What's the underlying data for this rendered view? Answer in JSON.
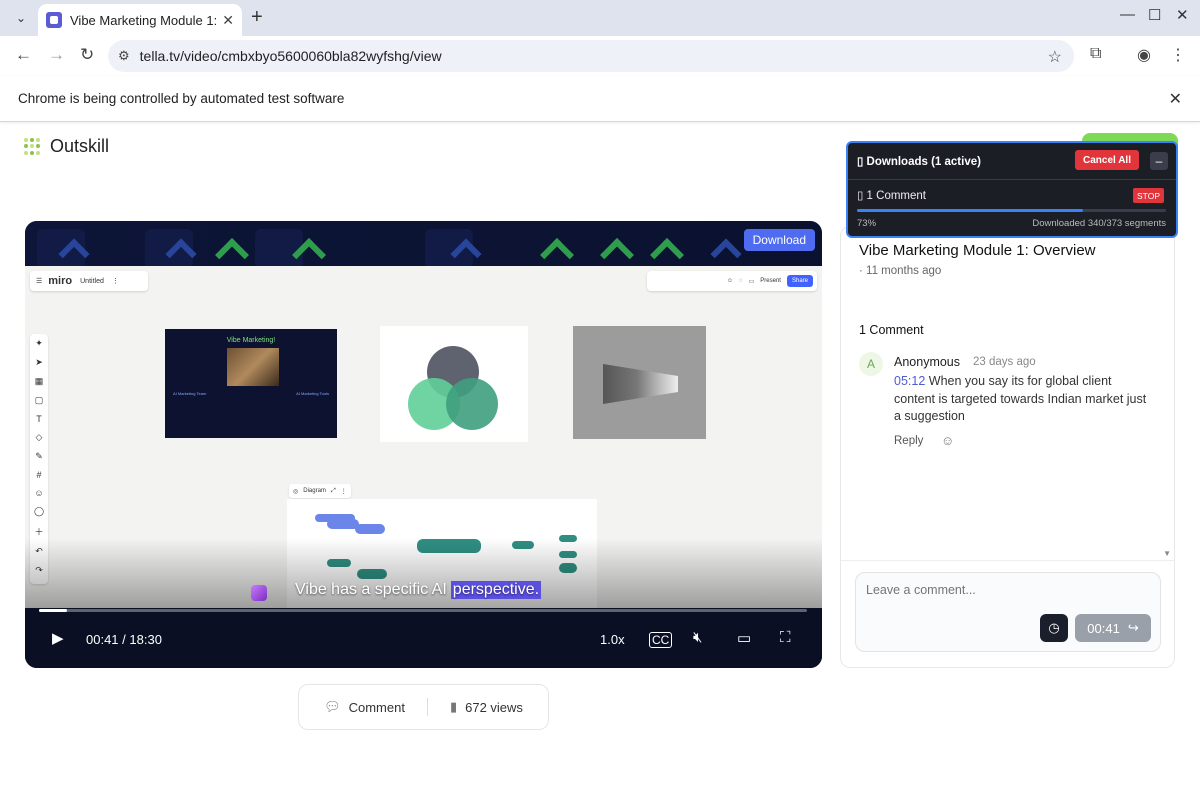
{
  "browser": {
    "tab_title": "Vibe Marketing Module 1: Overview",
    "url": "tella.tv/video/cmbxbyo5600060bla82wyfshg/view",
    "infobar_text": "Chrome is being controlled by automated test software"
  },
  "brand": {
    "name": "Outskill"
  },
  "video": {
    "download_label": "Download",
    "miro_logo": "miro",
    "board_name": "Untitled",
    "miro_present": "Present",
    "miro_share": "Share",
    "slide_title": "Vibe Marketing!",
    "slide_col1": "AI Marketing Team",
    "slide_col2": "AI Marketing Tools",
    "diagram_label": "Diagram",
    "caption_prefix": "Vibe has a specific AI",
    "caption_highlight": "perspective.",
    "current_time": "00:41",
    "duration": "18:30",
    "time_separator": "/",
    "speed": "1.0x",
    "progress_fraction": 0.037
  },
  "stats": {
    "comment_label": "Comment",
    "views_label": "672 views"
  },
  "panel": {
    "title": "Vibe Marketing Module 1: Overview",
    "age": "· 11 months ago",
    "comments_count": "1 Comment",
    "comment": {
      "avatar_letter": "A",
      "author": "Anonymous",
      "time": "23 days ago",
      "timestamp": "05:12",
      "text": "When you say its for global client content is targeted towards Indian market just a suggestion",
      "reply_label": "Reply"
    },
    "input_placeholder": "Leave a comment...",
    "time_button_label": "00:41"
  },
  "downloads": {
    "title": "Downloads (1 active)",
    "cancel_all": "Cancel All",
    "minimize": "–",
    "item_name": "1 Comment",
    "stop_label": "STOP",
    "percent": "73%",
    "status": "Downloaded 340/373 segments",
    "progress_fraction": 0.73
  },
  "colors": {
    "accent": "#4f6cf0",
    "danger": "#e0353b",
    "brand_green": "#7ed957",
    "download_blue": "#3b82f6"
  }
}
